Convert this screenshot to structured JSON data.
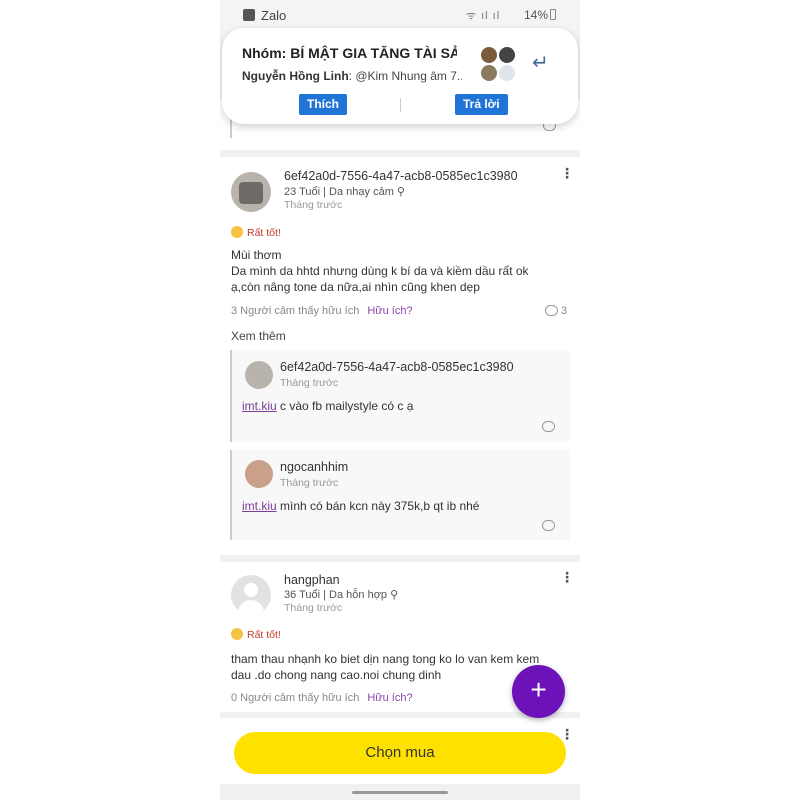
{
  "status_bar": {
    "app_name": "Zalo",
    "battery": "14%"
  },
  "notification": {
    "title": "Nhóm: BÍ MẬT GIA TĂNG TÀI SẢ..",
    "sender": "Nguyễn Hồng Linh",
    "message": ": @Kim Nhung âm 7..",
    "like_label": "Thích",
    "reply_label": "Trả lời"
  },
  "reviews": [
    {
      "username": "6ef42a0d-7556-4a47-acb8-0585ec1c3980",
      "meta": "23 Tuổi | Da nhạy cảm",
      "time": "Tháng trước",
      "rating": "Rất tốt!",
      "text_line1": "Mùi thơm",
      "text_line2": "Da mình da hhtd nhưng dùng k bí da và kiềm dầu rất ok ạ,còn nâng tone da nữa,ai nhìn cũng khen dẹp",
      "helpful": "3 Người cảm thấy hữu ích",
      "helpful_link": "Hữu ích?",
      "comment_count": "3",
      "see_more": "Xem thêm",
      "replies": [
        {
          "username": "6ef42a0d-7556-4a47-acb8-0585ec1c3980",
          "time": "Tháng trước",
          "mention": "imt.kiu",
          "text": " c vào fb mailystyle có c ạ"
        },
        {
          "username": "ngocanhhim",
          "time": "Tháng trước",
          "mention": "imt.kiu",
          "text": " mình có bán kcn này 375k,b qt ib nhé"
        }
      ]
    },
    {
      "username": "hangphan",
      "meta": "36 Tuổi | Da hỗn hợp",
      "time": "Tháng trước",
      "rating": "Rất tốt!",
      "text": "tham thau nhạnh ko biet dịn nang tong ko lo van kem kem dau .do chong nang cao.noi chung dinh",
      "helpful": "0 Người cảm thấy hữu ích",
      "helpful_link": "Hữu ích?"
    }
  ],
  "buy_button": "Chọn mua",
  "fab_symbol": "+"
}
